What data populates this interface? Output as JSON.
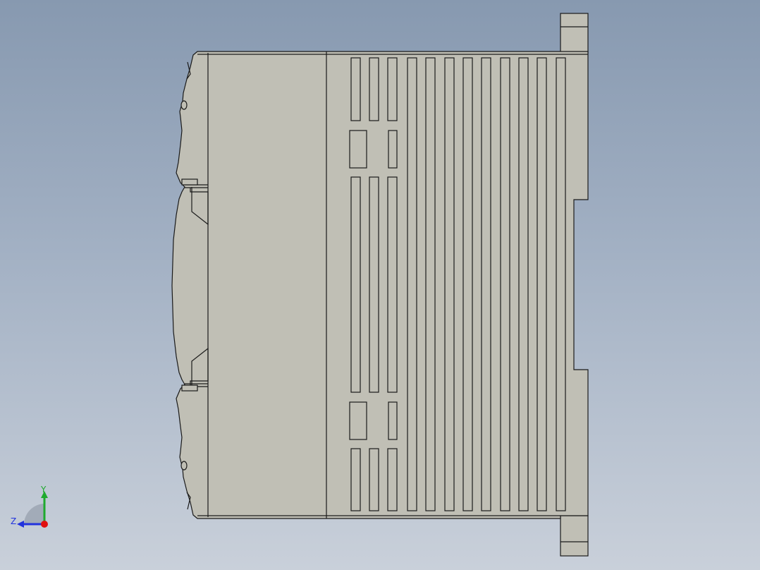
{
  "viewport": {
    "background_top": "#8799b0",
    "background_bottom": "#c9d0da"
  },
  "model": {
    "part_fill": "#c0bfb5",
    "edge_color": "#1a1a1a"
  },
  "triad": {
    "y_label": "Y",
    "z_label": "Z",
    "y_axis_color": "#1faa2e",
    "z_axis_color": "#2233dd",
    "origin_color": "#e01010"
  }
}
